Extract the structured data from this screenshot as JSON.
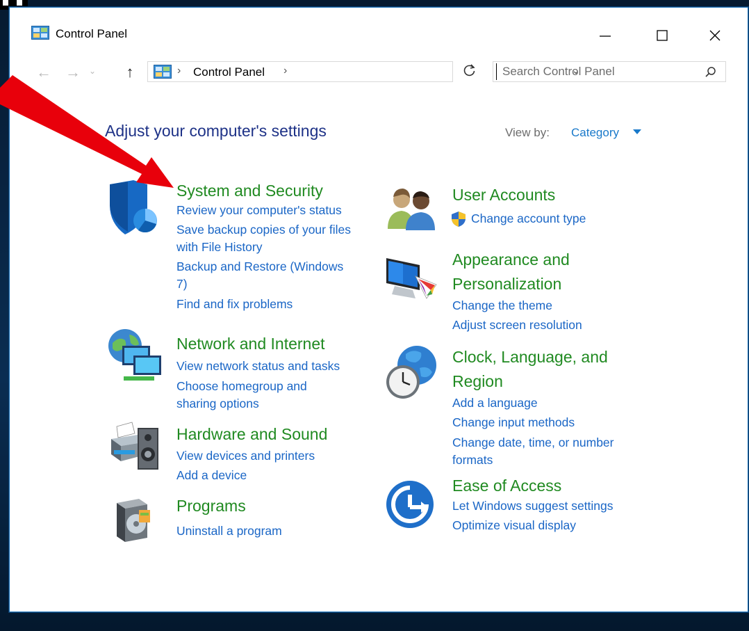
{
  "window": {
    "title": "Control Panel"
  },
  "address": {
    "crumb": "Control Panel",
    "search_placeholder": "Search Control Panel"
  },
  "page": {
    "heading": "Adjust your computer's settings",
    "view_by_label": "View by:",
    "view_by_value": "Category"
  },
  "categories": {
    "system_security": {
      "title": "System and Security",
      "links": [
        "Review your computer's status",
        "Save backup copies of your files",
        "with File History",
        "Backup and Restore (Windows",
        "7)",
        "Find and fix problems"
      ]
    },
    "network": {
      "title": "Network and Internet",
      "links": [
        "View network status and tasks",
        "Choose homegroup and",
        "sharing options"
      ]
    },
    "hardware": {
      "title": "Hardware and Sound",
      "links": [
        "View devices and printers",
        "Add a device"
      ]
    },
    "programs": {
      "title": "Programs",
      "links": [
        "Uninstall a program"
      ]
    },
    "user_accounts": {
      "title": "User Accounts",
      "links": [
        "Change account type"
      ]
    },
    "appearance": {
      "title_lines": [
        "Appearance and",
        "Personalization"
      ],
      "links": [
        "Change the theme",
        "Adjust screen resolution"
      ]
    },
    "clock": {
      "title_lines": [
        "Clock, Language, and",
        "Region"
      ],
      "links": [
        "Add a language",
        "Change input methods",
        "Change date, time, or number",
        "formats"
      ]
    },
    "ease": {
      "title": "Ease of Access",
      "links": [
        "Let Windows suggest settings",
        "Optimize visual display"
      ]
    }
  },
  "colors": {
    "heading_blue": "#1e3287",
    "category_green": "#208a21",
    "link_blue": "#1a66c6",
    "annotation_red": "#e8000b"
  }
}
